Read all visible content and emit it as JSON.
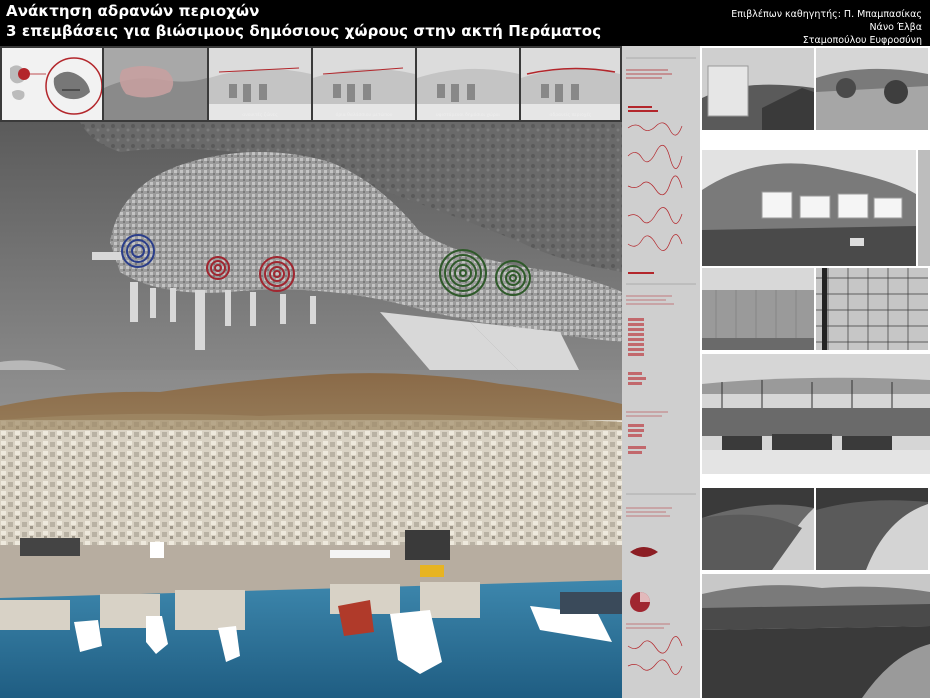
{
  "header": {
    "title": "Ανάκτηση αδρανών περιοχών",
    "subtitle": "3 επεμβάσεις για βιώσιμους δημόσιους χώρους στην ακτή Περάματος",
    "credits": [
      "Επιβλέπων καθηγητής: Π. Μπαμπασίκας",
      "Νάνο Έλβα",
      "Σταμοπούλου Ευφροσύνη"
    ]
  },
  "colors": {
    "accent_red": "#b3262b",
    "marker_blue": "#2b3e8a",
    "marker_red": "#a02630",
    "marker_green": "#2f5a2a",
    "sea": "#2f6f93"
  },
  "markers": [
    {
      "color": "blue",
      "rings": 3
    },
    {
      "color": "red",
      "rings": 3
    },
    {
      "color": "red",
      "rings": 4
    },
    {
      "color": "green",
      "rings": 5
    },
    {
      "color": "green",
      "rings": 4
    }
  ]
}
